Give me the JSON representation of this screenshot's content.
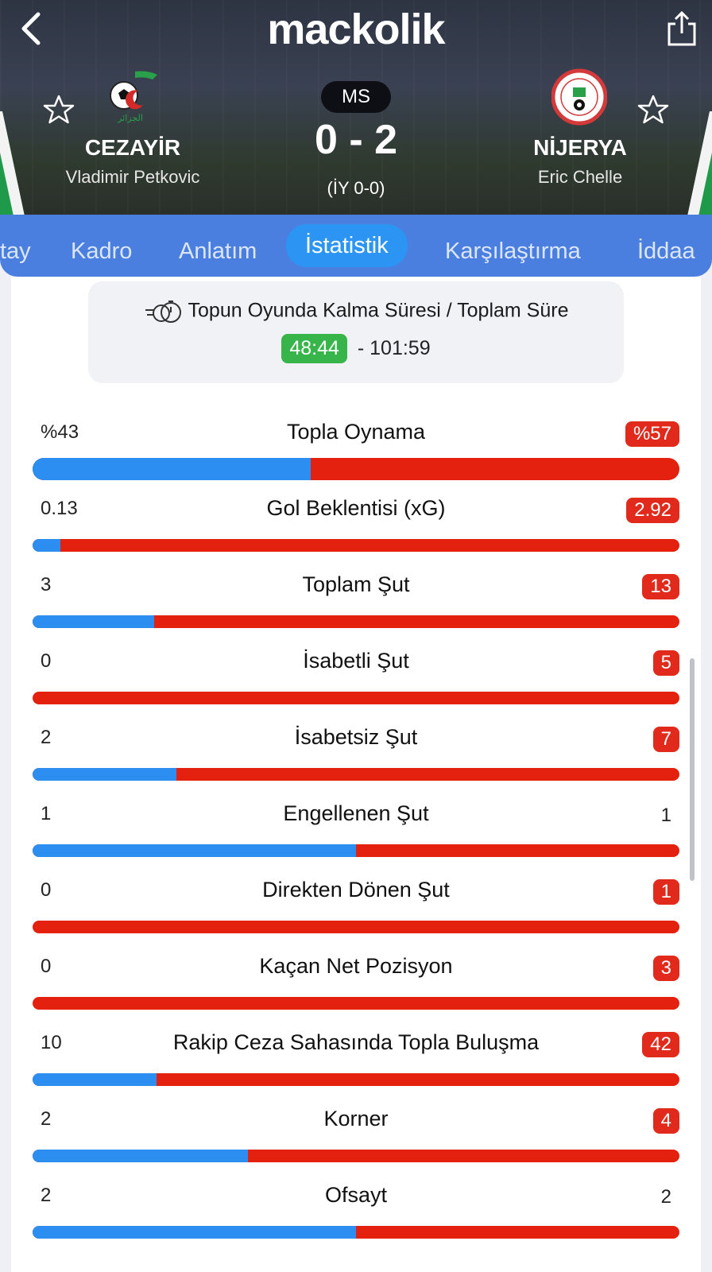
{
  "app": {
    "logo": "mackolik"
  },
  "match": {
    "status": "MS",
    "score": "0 - 2",
    "half_time": "(İY 0-0)",
    "home": {
      "name": "CEZAYİR",
      "coach": "Vladimir Petkovic"
    },
    "away": {
      "name": "NİJERYA",
      "coach": "Eric Chelle"
    }
  },
  "tabs": [
    {
      "label": "tay",
      "active": false
    },
    {
      "label": "Kadro",
      "active": false
    },
    {
      "label": "Anlatım",
      "active": false
    },
    {
      "label": "İstatistik",
      "active": true
    },
    {
      "label": "Karşılaştırma",
      "active": false
    },
    {
      "label": "İddaa",
      "active": false
    }
  ],
  "ball_time": {
    "title": "Topun Oyunda Kalma Süresi / Toplam Süre",
    "in_play": "48:44",
    "total": "- 101:59"
  },
  "stats": [
    {
      "label": "Topla Oynama",
      "home": "%43",
      "away": "%57",
      "home_frac": 0.43,
      "winner": "away"
    },
    {
      "label": "Gol Beklentisi (xG)",
      "home": "0.13",
      "away": "2.92",
      "home_frac": 0.043,
      "winner": "away"
    },
    {
      "label": "Toplam Şut",
      "home": "3",
      "away": "13",
      "home_frac": 0.1875,
      "winner": "away"
    },
    {
      "label": "İsabetli Şut",
      "home": "0",
      "away": "5",
      "home_frac": 0,
      "winner": "away"
    },
    {
      "label": "İsabetsiz Şut",
      "home": "2",
      "away": "7",
      "home_frac": 0.222,
      "winner": "away"
    },
    {
      "label": "Engellenen Şut",
      "home": "1",
      "away": "1",
      "home_frac": 0.5,
      "winner": "none"
    },
    {
      "label": "Direkten Dönen Şut",
      "home": "0",
      "away": "1",
      "home_frac": 0,
      "winner": "away"
    },
    {
      "label": "Kaçan Net Pozisyon",
      "home": "0",
      "away": "3",
      "home_frac": 0,
      "winner": "away"
    },
    {
      "label": "Rakip Ceza Sahasında Topla Buluşma",
      "home": "10",
      "away": "42",
      "home_frac": 0.192,
      "winner": "away"
    },
    {
      "label": "Korner",
      "home": "2",
      "away": "4",
      "home_frac": 0.333,
      "winner": "away"
    },
    {
      "label": "Ofsayt",
      "home": "2",
      "away": "2",
      "home_frac": 0.5,
      "winner": "none"
    }
  ],
  "colors": {
    "home_bar": "#2c8ef0",
    "away_bar": "#e4210e",
    "accent_tab": "#2c95f3",
    "tabbar": "#4a7fdf"
  }
}
